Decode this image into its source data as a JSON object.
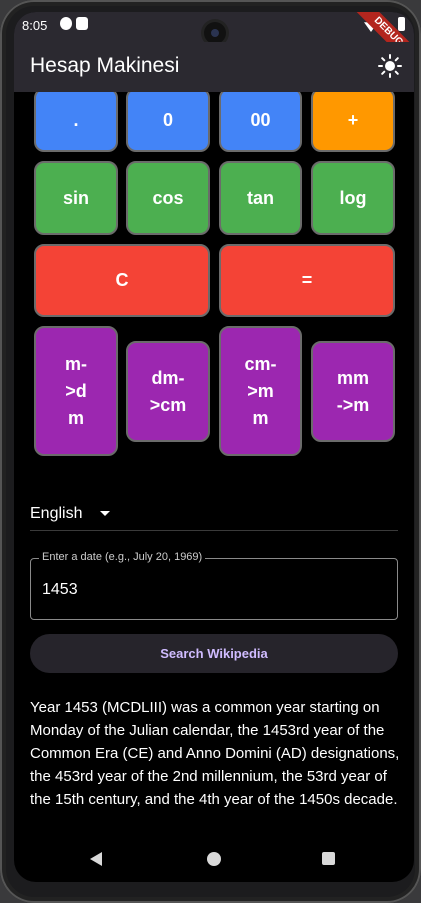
{
  "status_bar": {
    "time": "8:05",
    "debug_banner": "DEBUG"
  },
  "app_bar": {
    "title": "Hesap Makinesi",
    "theme_icon": "sun-icon"
  },
  "keypad": {
    "row1": [
      ".",
      "0",
      "00",
      "+"
    ],
    "row2": [
      "sin",
      "cos",
      "tan",
      "log"
    ],
    "row3": [
      "C",
      "="
    ],
    "row4": [
      "m-\n>d\nm",
      "dm-\n>cm",
      "cm-\n>m\nm",
      "mm\n->m"
    ]
  },
  "language_select": {
    "value": "English",
    "icon": "dropdown-arrow-icon"
  },
  "date_field": {
    "label": "Enter a date (e.g., July 20, 1969)",
    "value": "1453"
  },
  "search_button": {
    "label": "Search Wikipedia"
  },
  "result": {
    "text": " Year 1453 (MCDLIII) was a common year starting on Monday of the Julian calendar, the 1453rd year of the Common Era (CE) and Anno Domini (AD) designations, the 453rd year of the 2nd millennium, the 53rd year of the 15th century, and the 4th year of the 1450s decade."
  },
  "colors": {
    "blue": "#4384f7",
    "orange": "#ff9800",
    "green": "#4caf50",
    "red": "#f44336",
    "purple": "#9c27b0",
    "accent": "#d0bcff"
  }
}
